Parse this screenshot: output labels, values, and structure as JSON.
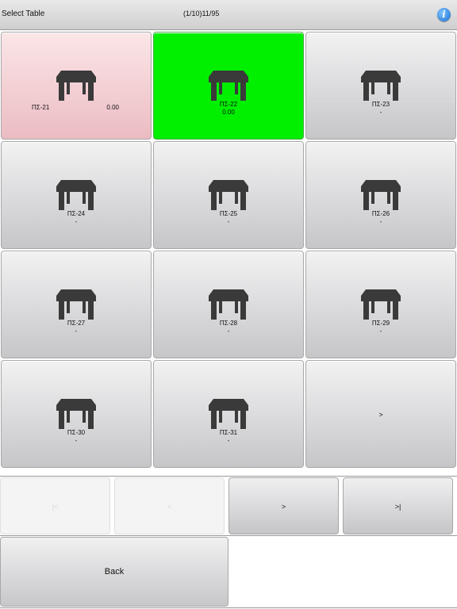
{
  "header": {
    "title": "Select Table",
    "pager": "(1/10)11/95",
    "info_icon": "info-icon"
  },
  "colors": {
    "selected": "#00f000",
    "occupied": "#f3cdd2",
    "button": "#d9d9dc"
  },
  "tables": [
    {
      "name": "ΠΣ-21",
      "amount": "0.00",
      "state": "occupied",
      "icon": "table-icon"
    },
    {
      "name": "ΠΣ-22",
      "amount": "0.00",
      "state": "selected",
      "icon": "table-icon"
    },
    {
      "name": "ΠΣ-23",
      "amount": "-",
      "state": "free",
      "icon": "table-icon"
    },
    {
      "name": "ΠΣ-24",
      "amount": "-",
      "state": "free",
      "icon": "table-icon"
    },
    {
      "name": "ΠΣ-25",
      "amount": "-",
      "state": "free",
      "icon": "table-icon"
    },
    {
      "name": "ΠΣ-26",
      "amount": "-",
      "state": "free",
      "icon": "table-icon"
    },
    {
      "name": "ΠΣ-27",
      "amount": "-",
      "state": "free",
      "icon": "table-icon"
    },
    {
      "name": "ΠΣ-28",
      "amount": "-",
      "state": "free",
      "icon": "table-icon"
    },
    {
      "name": "ΠΣ-29",
      "amount": "-",
      "state": "free",
      "icon": "table-icon"
    },
    {
      "name": "ΠΣ-30",
      "amount": "-",
      "state": "free",
      "icon": "table-icon"
    },
    {
      "name": "ΠΣ-31",
      "amount": "-",
      "state": "free",
      "icon": "table-icon"
    }
  ],
  "grid_next": {
    "label": ">"
  },
  "nav": {
    "first": {
      "label": "|<",
      "enabled": false
    },
    "prev": {
      "label": "<",
      "enabled": false
    },
    "next": {
      "label": ">",
      "enabled": true
    },
    "last": {
      "label": ">|",
      "enabled": true
    }
  },
  "back": {
    "label": "Back"
  }
}
